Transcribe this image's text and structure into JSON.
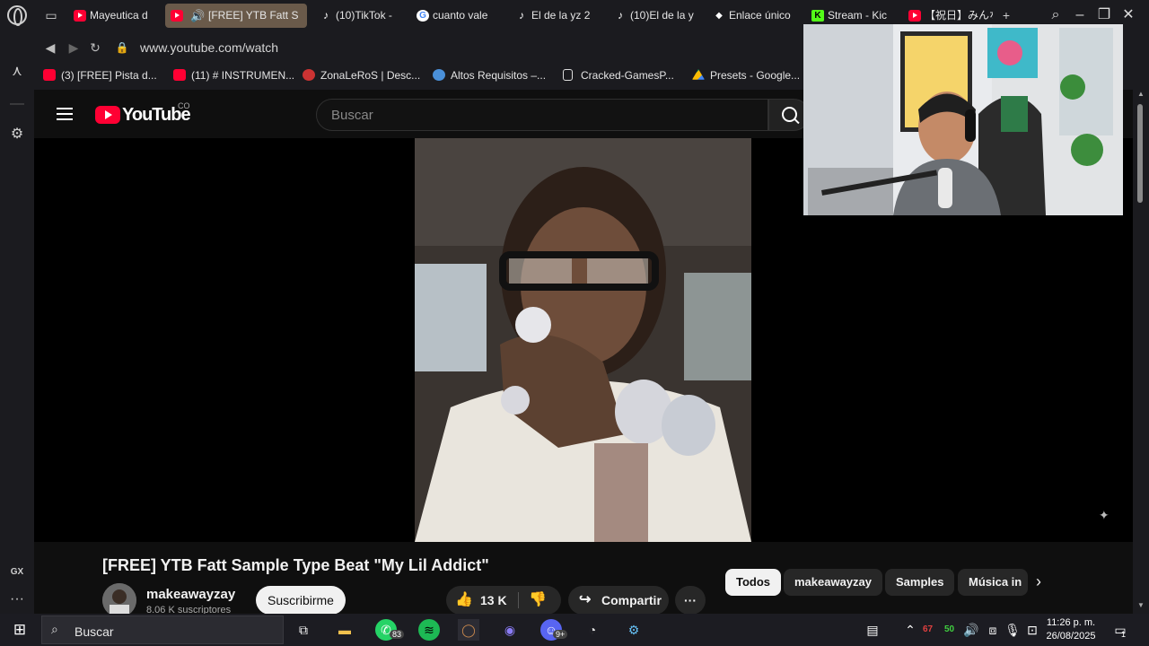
{
  "browser": {
    "tabs": [
      {
        "label": "Mayeutica d",
        "icon": "youtube-icon"
      },
      {
        "label": "[FREE] YTB Fatt S",
        "icon": "youtube-icon",
        "active": true
      },
      {
        "label": "(10)TikTok -",
        "icon": "tiktok-icon"
      },
      {
        "label": "cuanto vale",
        "icon": "google-icon"
      },
      {
        "label": "El de la yz 2",
        "icon": "tiktok-icon"
      },
      {
        "label": "(10)El de la y",
        "icon": "tiktok-icon"
      },
      {
        "label": "Enlace único",
        "icon": "link-icon"
      },
      {
        "label": "Stream - Kic",
        "icon": "kick-icon"
      },
      {
        "label": "【祝日】みんな",
        "icon": "youtube-icon"
      }
    ],
    "url": "www.youtube.com/watch",
    "bookmarks": [
      {
        "label": "(3) [FREE] Pista d...",
        "icon": "youtube-icon"
      },
      {
        "label": "(11) # INSTRUMEN...",
        "icon": "youtube-icon"
      },
      {
        "label": "ZonaLeRoS | Desc...",
        "icon": "zonaleros-icon"
      },
      {
        "label": "Altos Requisitos –...",
        "icon": "globe-icon"
      },
      {
        "label": "Cracked-GamesP...",
        "icon": "page-icon"
      },
      {
        "label": "Presets - Google...",
        "icon": "drive-icon"
      }
    ],
    "sidebar_badge": "GX"
  },
  "youtube": {
    "logo_text": "YouTube",
    "country": "CO",
    "search_placeholder": "Buscar",
    "video_title": "[FREE] YTB Fatt Sample Type Beat \"My Lil Addict\"",
    "channel_name": "makeawayzay",
    "channel_subs": "8.06 K suscriptores",
    "subscribe_label": "Suscribirme",
    "likes": "13 K",
    "share_label": "Compartir",
    "chips": [
      "Todos",
      "makeawayzay",
      "Samples",
      "Música in"
    ]
  },
  "taskbar": {
    "search_placeholder": "Buscar",
    "whatsapp_badge": "83",
    "discord_badge": "9+",
    "tray_values": [
      "67",
      "50"
    ],
    "time": "11:26 p. m.",
    "date": "26/08/2025",
    "notif_count": "1"
  }
}
